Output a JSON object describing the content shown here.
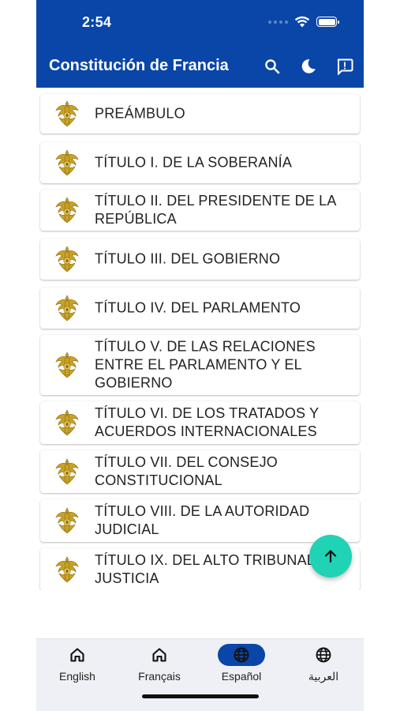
{
  "status_bar": {
    "time": "2:54"
  },
  "app_bar": {
    "title": "Constitución de Francia",
    "actions": [
      "search-icon",
      "dark-mode-icon",
      "feedback-icon"
    ]
  },
  "colors": {
    "primary": "#0a46a8",
    "fab": "#1fd3b4",
    "nav_background": "#eff0f5",
    "emblem_gold": "#c9a227"
  },
  "sections": [
    {
      "label": "PREÁMBULO"
    },
    {
      "label": "TÍTULO I. DE LA SOBERANÍA"
    },
    {
      "label": "TÍTULO II. DEL PRESIDENTE DE LA REPÚBLICA"
    },
    {
      "label": "TÍTULO III. DEL GOBIERNO"
    },
    {
      "label": "TÍTULO IV. DEL PARLAMENTO"
    },
    {
      "label": "TÍTULO V. DE LAS RELACIONES ENTRE EL PARLAMENTO Y EL GOBIERNO"
    },
    {
      "label": "TÍTULO VI. DE LOS TRATADOS Y ACUERDOS INTERNACIONALES"
    },
    {
      "label": "TÍTULO VII. DEL CONSEJO CONSTITUCIONAL"
    },
    {
      "label": "TÍTULO VIII. DE LA AUTORIDAD JUDICIAL"
    },
    {
      "label": "TÍTULO IX. DEL ALTO TRIBUNAL DE JUSTICIA"
    }
  ],
  "fab": {
    "icon": "arrow-up-icon"
  },
  "bottom_nav": {
    "items": [
      {
        "label": "English",
        "icon": "home-icon",
        "active": false
      },
      {
        "label": "Français",
        "icon": "home-icon",
        "active": false
      },
      {
        "label": "Español",
        "icon": "globe-icon",
        "active": true
      },
      {
        "label": "العربية",
        "icon": "globe-icon",
        "active": false
      }
    ]
  }
}
